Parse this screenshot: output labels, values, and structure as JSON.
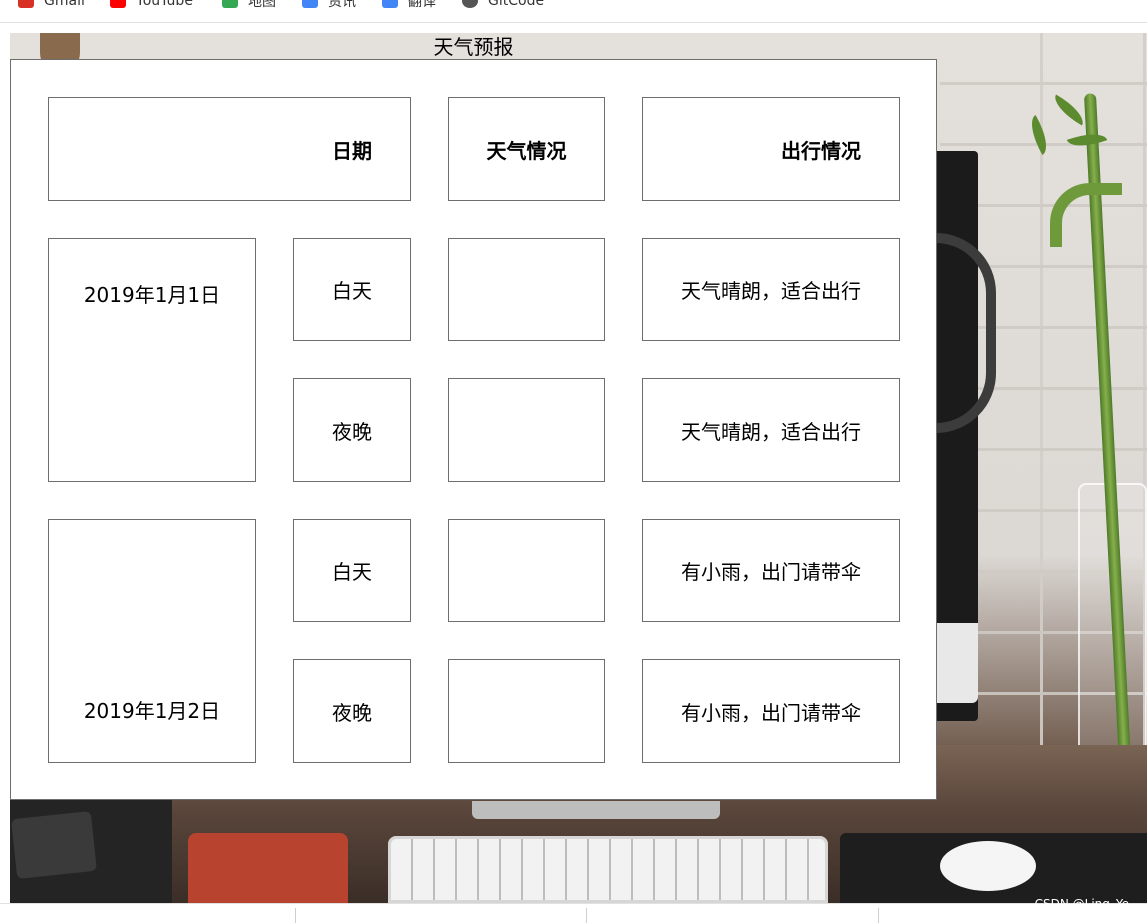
{
  "bookmarks": [
    {
      "label": "Gmail",
      "icon": "gmail-icon",
      "color": "#d93025"
    },
    {
      "label": "YouTube",
      "icon": "youtube-icon",
      "color": "#ff0000"
    },
    {
      "label": "地图",
      "icon": "maps-icon",
      "color": "#34a853"
    },
    {
      "label": "资讯",
      "icon": "news-icon",
      "color": "#4285f4"
    },
    {
      "label": "翻译",
      "icon": "translate-icon",
      "color": "#4285f4"
    },
    {
      "label": "GitCode",
      "icon": "gitcode-icon",
      "color": "#555555"
    }
  ],
  "page": {
    "title": "天气预报"
  },
  "table": {
    "headers": {
      "date": "日期",
      "weather": "天气情况",
      "travel": "出行情况"
    },
    "days": [
      {
        "date": "2019年1月1日",
        "rows": [
          {
            "period": "白天",
            "weather": "",
            "travel": "天气晴朗，适合出行"
          },
          {
            "period": "夜晚",
            "weather": "",
            "travel": "天气晴朗，适合出行"
          }
        ]
      },
      {
        "date": "2019年1月2日",
        "rows": [
          {
            "period": "白天",
            "weather": "",
            "travel": "有小雨，出门请带伞"
          },
          {
            "period": "夜晚",
            "weather": "",
            "travel": "有小雨，出门请带伞"
          }
        ]
      }
    ]
  },
  "watermark": "CSDN @Ling_Ye_"
}
